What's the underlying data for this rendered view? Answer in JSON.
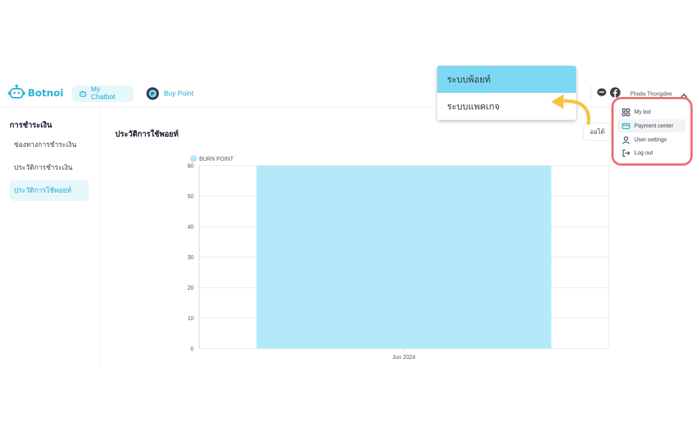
{
  "header": {
    "logo_text": "Botnoi",
    "nav": [
      {
        "label": "My Chatbot",
        "icon": "robot-icon"
      },
      {
        "label": "Buy Point",
        "icon": "coin-icon"
      }
    ],
    "user_name": "Phaila Thongdee"
  },
  "sidebar": {
    "title": "การชำระเงิน",
    "items": [
      {
        "label": "ช่องทางการชำระเงิน",
        "active": false
      },
      {
        "label": "ประวัติการชำระเงิน",
        "active": false
      },
      {
        "label": "ประวัติการใช้พอยท์",
        "active": true
      }
    ]
  },
  "main": {
    "title": "ประวัติการใช้พอยท์",
    "filter_label": "ออไต้"
  },
  "package_menu": {
    "items": [
      {
        "label": "ระบบพ้อยท์",
        "active": true
      },
      {
        "label": "ระบบแพคเกจ",
        "active": false
      }
    ]
  },
  "user_menu": {
    "items": [
      {
        "label": "My bot",
        "icon": "grid-icon"
      },
      {
        "label": "Payment center",
        "icon": "credit-card-icon",
        "active": true
      },
      {
        "label": "User settings",
        "icon": "user-icon"
      },
      {
        "label": "Log out",
        "icon": "logout-icon"
      }
    ]
  },
  "colors": {
    "accent": "#20a9d0",
    "bar": "#b3e9f9",
    "highlight": "#ef6b6b",
    "arrow": "#f5c542"
  },
  "chart_data": {
    "type": "bar",
    "categories": [
      "Jun 2024"
    ],
    "series": [
      {
        "name": "BURN POINT",
        "values": [
          60
        ]
      }
    ],
    "ylim": [
      0,
      60
    ],
    "yticks": [
      0,
      10,
      20,
      30,
      40,
      50,
      60
    ],
    "grid": true,
    "legend": "top-left"
  }
}
